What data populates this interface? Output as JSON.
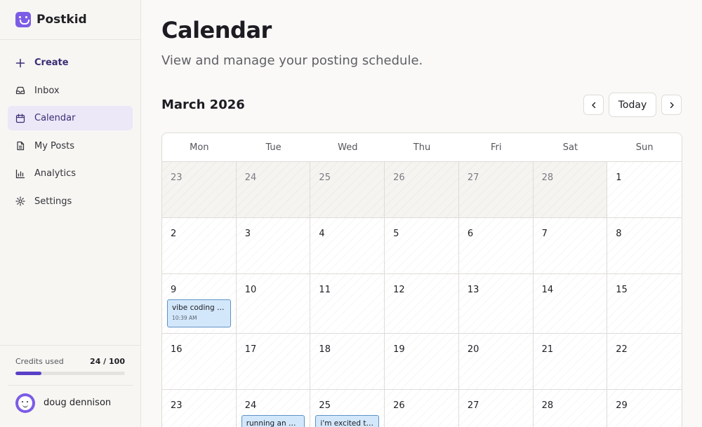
{
  "app": {
    "name": "Postkid"
  },
  "sidebar": {
    "items": [
      {
        "label": "Create",
        "icon": "plus-icon"
      },
      {
        "label": "Inbox",
        "icon": "inbox-icon"
      },
      {
        "label": "Calendar",
        "icon": "calendar-icon",
        "active": true
      },
      {
        "label": "My Posts",
        "icon": "document-icon"
      },
      {
        "label": "Analytics",
        "icon": "bar-chart-icon"
      },
      {
        "label": "Settings",
        "icon": "gear-icon"
      }
    ],
    "credits": {
      "label": "Credits used",
      "value": "24 / 100",
      "used": 24,
      "total": 100
    },
    "user": {
      "name": "doug dennison"
    }
  },
  "main": {
    "title": "Calendar",
    "subtitle": "View and manage your posting schedule.",
    "month": "March 2026",
    "today_label": "Today",
    "weekdays": [
      "Mon",
      "Tue",
      "Wed",
      "Thu",
      "Fri",
      "Sat",
      "Sun"
    ],
    "weeks": [
      [
        "23",
        "24",
        "25",
        "26",
        "27",
        "28",
        "1"
      ],
      [
        "2",
        "3",
        "4",
        "5",
        "6",
        "7",
        "8"
      ],
      [
        "9",
        "10",
        "11",
        "12",
        "13",
        "14",
        "15"
      ],
      [
        "16",
        "17",
        "18",
        "19",
        "20",
        "21",
        "22"
      ],
      [
        "23",
        "24",
        "25",
        "26",
        "27",
        "28",
        "29"
      ]
    ],
    "events": [
      {
        "title": "vibe coding is…",
        "time": "10:39 AM"
      },
      {
        "title": "running an e…"
      },
      {
        "title": "i'm excited to …"
      }
    ]
  },
  "colors": {
    "accent": "#7c5ce6",
    "active_nav_bg": "#ece8f8",
    "event_bg": "#d3e7fb",
    "event_border": "#5e93c6",
    "progress_fill": "#5a3fc7"
  }
}
